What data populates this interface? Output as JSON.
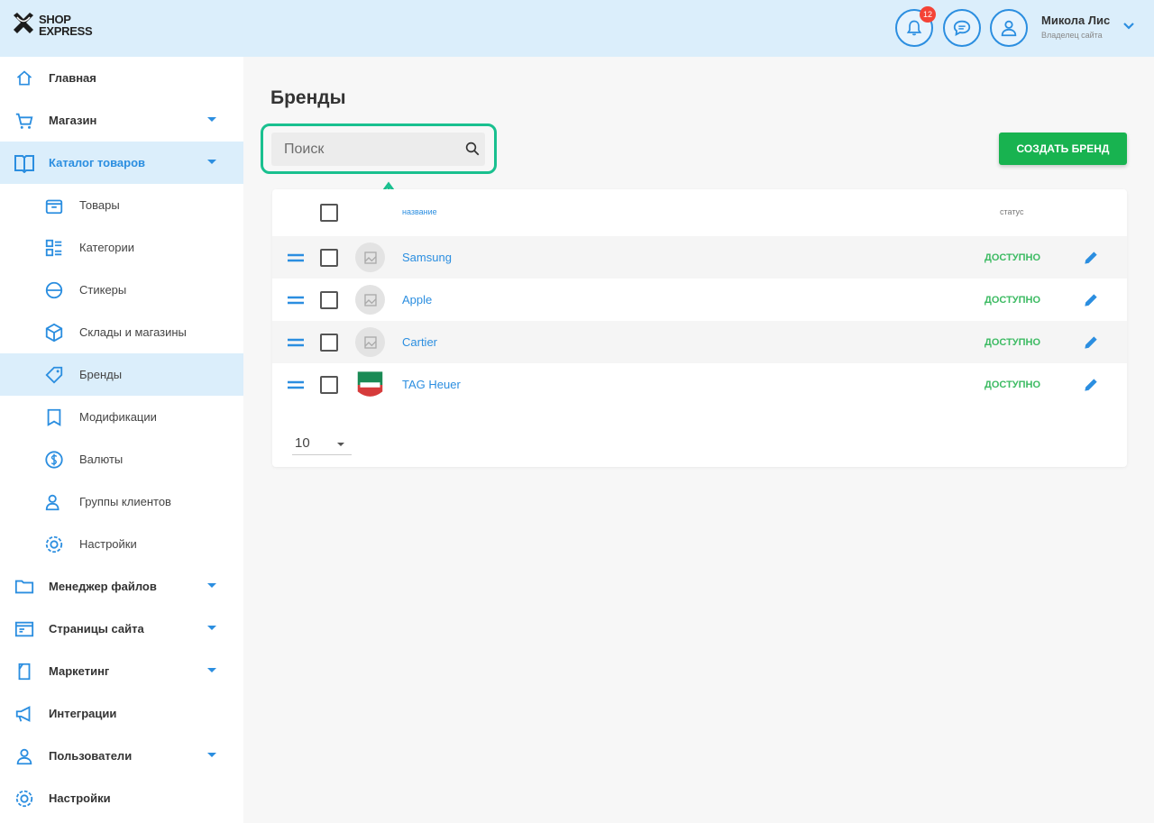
{
  "colors": {
    "accent": "#2b8ee0",
    "header_bg": "#dbeefb",
    "highlight": "#19c08f",
    "create_button": "#18b350",
    "status_available": "#3dbb63",
    "badge": "#f44336"
  },
  "header": {
    "logo_line1": "SHOP",
    "logo_line2": "EXPRESS",
    "notifications_count": "12",
    "user_name": "Микола Лис",
    "user_role": "Владелец сайта"
  },
  "sidebar": {
    "items": [
      {
        "label": "Главная",
        "icon": "home-icon"
      },
      {
        "label": "Магазин",
        "icon": "cart-icon"
      },
      {
        "label": "Каталог товаров",
        "icon": "book-icon"
      },
      {
        "label": "Товары",
        "icon": "box-icon"
      },
      {
        "label": "Категории",
        "icon": "categories-icon"
      },
      {
        "label": "Стикеры",
        "icon": "sticker-icon"
      },
      {
        "label": "Склады и магазины",
        "icon": "warehouse-icon"
      },
      {
        "label": "Бренды",
        "icon": "tag-icon"
      },
      {
        "label": "Модификации",
        "icon": "bookmark-icon"
      },
      {
        "label": "Валюты",
        "icon": "dollar-icon"
      },
      {
        "label": "Группы клиентов",
        "icon": "users-icon"
      },
      {
        "label": "Настройки",
        "icon": "gear-icon"
      },
      {
        "label": "Менеджер файлов",
        "icon": "folder-icon"
      },
      {
        "label": "Страницы сайта",
        "icon": "pages-icon"
      },
      {
        "label": "Маркетинг",
        "icon": "marketing-icon"
      },
      {
        "label": "Интеграции",
        "icon": "megaphone-icon"
      },
      {
        "label": "Пользователи",
        "icon": "user-icon"
      },
      {
        "label": "Настройки",
        "icon": "gear-icon"
      }
    ]
  },
  "main": {
    "title": "Бренды",
    "search_placeholder": "Поиск",
    "create_button": "СОЗДАТЬ БРЕНД",
    "table": {
      "col_name": "название",
      "col_status": "статус",
      "rows": [
        {
          "name": "Samsung",
          "status": "доступно"
        },
        {
          "name": "Apple",
          "status": "доступно"
        },
        {
          "name": "Cartier",
          "status": "доступно"
        },
        {
          "name": "TAG Heuer",
          "status": "доступно"
        }
      ]
    },
    "per_page": "10"
  }
}
